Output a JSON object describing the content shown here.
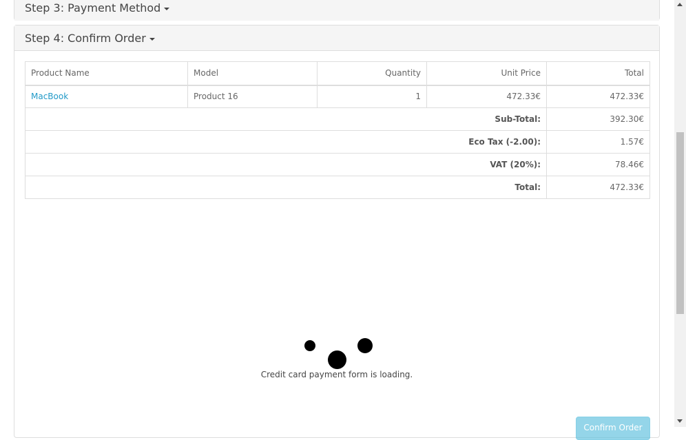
{
  "steps": {
    "step3": {
      "label": "Step 3: Payment Method"
    },
    "step4": {
      "label": "Step 4: Confirm Order"
    }
  },
  "table": {
    "headers": [
      "Product Name",
      "Model",
      "Quantity",
      "Unit Price",
      "Total"
    ],
    "rows": [
      {
        "product": "MacBook",
        "model": "Product 16",
        "quantity": "1",
        "unit_price": "472.33€",
        "total": "472.33€"
      }
    ],
    "totals": [
      {
        "label": "Sub-Total:",
        "value": "392.30€"
      },
      {
        "label": "Eco Tax (-2.00):",
        "value": "1.57€"
      },
      {
        "label": "VAT (20%):",
        "value": "78.46€"
      },
      {
        "label": "Total:",
        "value": "472.33€"
      }
    ]
  },
  "loading": {
    "message": "Credit card payment form is loading."
  },
  "confirm_button": {
    "label": "Confirm Order"
  },
  "icons": {
    "caret": "caret-down-icon",
    "spinner": "loading-spinner-icon"
  },
  "colors": {
    "link": "#229ac8",
    "button": "#5bc0de",
    "heading_bg": "#f5f5f5"
  }
}
